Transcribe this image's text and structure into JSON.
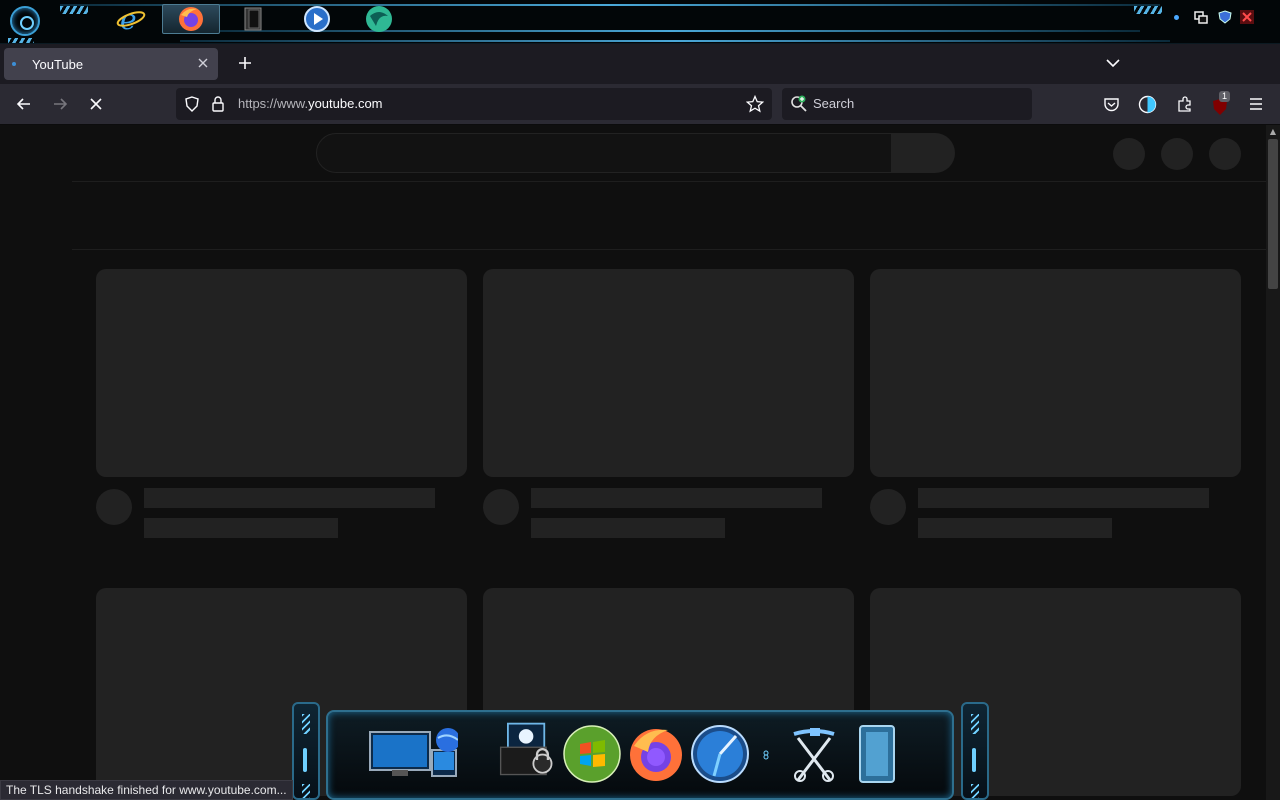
{
  "taskbar": {
    "buttons": [
      {
        "name": "internet-explorer",
        "active": false
      },
      {
        "name": "firefox",
        "active": true
      },
      {
        "name": "file-manager",
        "active": false
      },
      {
        "name": "media-player",
        "active": false
      },
      {
        "name": "browser-app",
        "active": false
      }
    ],
    "tray": [
      "network-icon",
      "shield-icon",
      "close-app-icon"
    ]
  },
  "tabs": [
    {
      "title": "YouTube",
      "active": true
    }
  ],
  "navbar": {
    "url_prefix": "https://www.",
    "url_host": "youtube.com",
    "search_placeholder": "Search",
    "extension_badge": "1"
  },
  "status_text": "The TLS handshake finished for www.youtube.com...",
  "dock": {
    "icons": [
      "computer-icon",
      "network-icon",
      "lock-folder-icon",
      "windows-icon",
      "firefox-icon",
      "safari-icon",
      "tools-icon",
      "recycle-bin-icon"
    ]
  },
  "colors": {
    "accent": "#3b9fd6",
    "page_bg": "#0f0f0f",
    "skeleton": "#222222"
  }
}
